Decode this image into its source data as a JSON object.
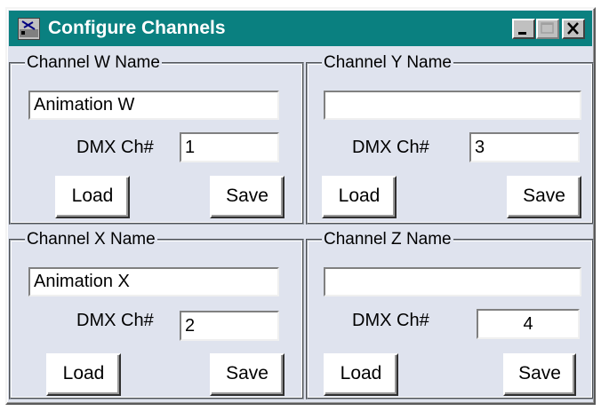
{
  "window": {
    "title": "Configure Channels",
    "app_icon": "app-icon",
    "controls": [
      "minimize-icon",
      "maximize-icon",
      "close-icon"
    ]
  },
  "channels": [
    {
      "legend": "Channel W  Name",
      "name_value": "Animation W",
      "dmx_label": "DMX Ch#",
      "dmx_value": "1",
      "load_label": "Load",
      "save_label": "Save"
    },
    {
      "legend": "Channel Y  Name",
      "name_value": "",
      "dmx_label": "DMX Ch#",
      "dmx_value": "3",
      "load_label": "Load",
      "save_label": "Save"
    },
    {
      "legend": "Channel X  Name",
      "name_value": "Animation X",
      "dmx_label": "DMX Ch#",
      "dmx_value": "2",
      "load_label": "Load",
      "save_label": "Save"
    },
    {
      "legend": "Channel Z  Name",
      "name_value": "",
      "dmx_label": "DMX Ch#",
      "dmx_value": "4",
      "load_label": "Load",
      "save_label": "Save"
    }
  ]
}
